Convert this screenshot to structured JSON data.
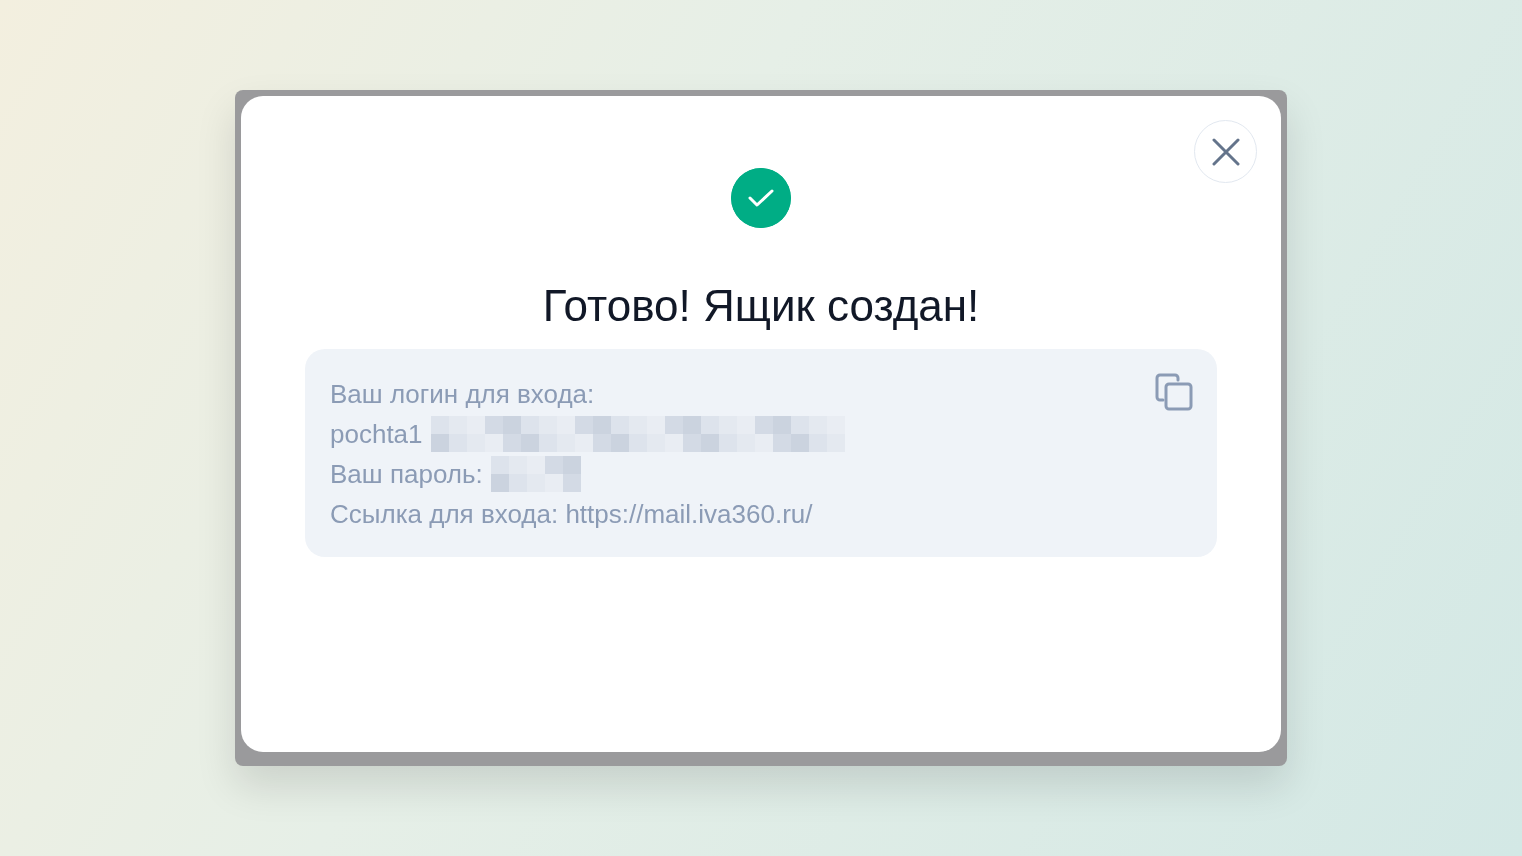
{
  "dialog": {
    "title": "Готово! Ящик создан!",
    "credentials": [
      {
        "kind": "label",
        "text": "Ваш логин для входа:"
      },
      {
        "kind": "redacted",
        "text": "pochta1"
      },
      {
        "kind": "redacted",
        "text": "Ваш пароль:"
      },
      {
        "kind": "label",
        "text": "Ссылка для входа: https://mail.iva360.ru/"
      }
    ]
  }
}
